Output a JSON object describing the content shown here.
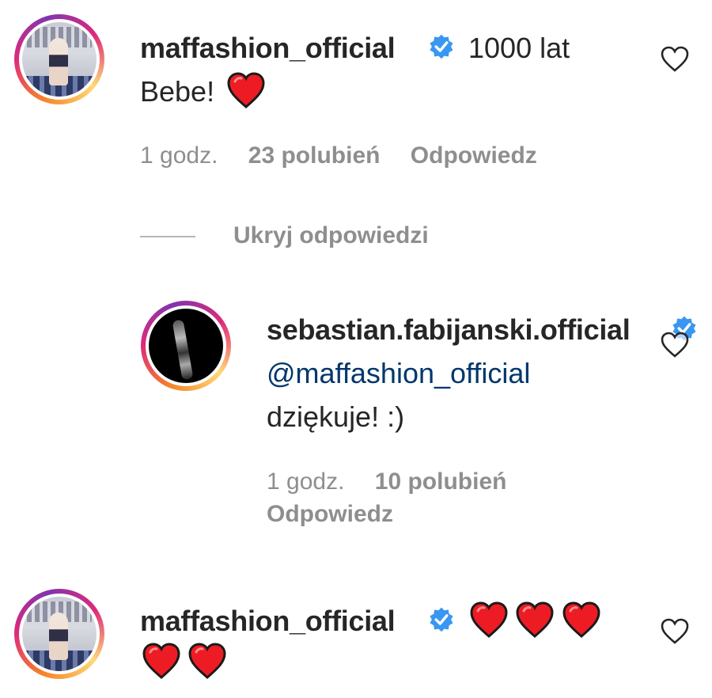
{
  "comments": [
    {
      "username": "maffashion_official",
      "verified": true,
      "text_line1": "1000 lat",
      "text_line2": "Bebe!",
      "emoji": [
        "red-heart"
      ],
      "time": "1 godz.",
      "likes": "23 polubień",
      "reply": "Odpowiedz",
      "hide_replies": "Ukryj odpowiedzi",
      "replies": [
        {
          "username": "sebastian.fabijanski.official",
          "verified": true,
          "mention": "@maffashion_official",
          "text": "dziękuje! :)",
          "time": "1 godz.",
          "likes": "10 polubień",
          "reply": "Odpowiedz"
        }
      ]
    },
    {
      "username": "maffashion_official",
      "verified": true,
      "emoji": [
        "red-heart",
        "red-heart",
        "red-heart",
        "red-heart",
        "red-heart"
      ]
    }
  ],
  "colors": {
    "text": "#262626",
    "secondary": "#8e8e8e",
    "link": "#00376b",
    "verified": "#3897f0",
    "heart": "#ed1c24"
  }
}
